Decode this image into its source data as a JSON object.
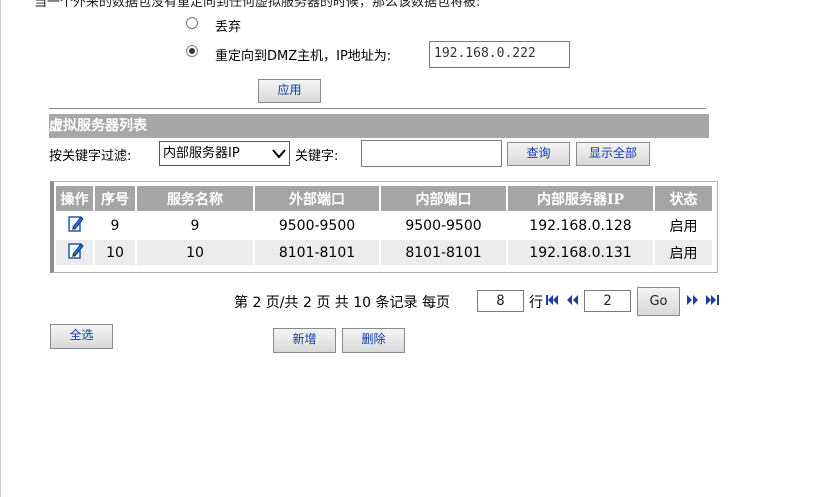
{
  "top_text": "当一个外来的数据包没有重定向到任何虚拟服务器的时候，那么该数据包将被:",
  "options": [
    {
      "label": "丢弃",
      "checked": false
    },
    {
      "label": "重定向到DMZ主机，IP地址为:",
      "checked": true
    }
  ],
  "dmz_ip": "192.168.0.222",
  "apply_label": "应用",
  "section_title": "虚拟服务器列表",
  "filter": {
    "label": "按关键字过滤:",
    "select_value": "内部服务器IP",
    "keyword_label": "关键字:",
    "keyword_value": "",
    "query_label": "查询",
    "show_all_label": "显示全部"
  },
  "table": {
    "headers": [
      "操作",
      "序号",
      "服务名称",
      "外部端口",
      "内部端口",
      "内部服务器IP",
      "状态"
    ],
    "rows": [
      {
        "index": "9",
        "name": "9",
        "ext_port": "9500-9500",
        "int_port": "9500-9500",
        "ip": "192.168.0.128",
        "status": "启用"
      },
      {
        "index": "10",
        "name": "10",
        "ext_port": "8101-8101",
        "int_port": "8101-8101",
        "ip": "192.168.0.131",
        "status": "启用"
      }
    ]
  },
  "pagination": {
    "summary": "第 2 页/共 2 页 共 10 条记录 每页",
    "per_page": "8",
    "row_label": "行",
    "page_input": "2",
    "go_label": "Go"
  },
  "select_all_label": "全选",
  "add_label": "新增",
  "delete_label": "删除",
  "icons": {
    "edit": "edit-icon",
    "first": "first-page-icon",
    "prev": "prev-page-icon",
    "next": "next-page-icon",
    "last": "last-page-icon"
  }
}
